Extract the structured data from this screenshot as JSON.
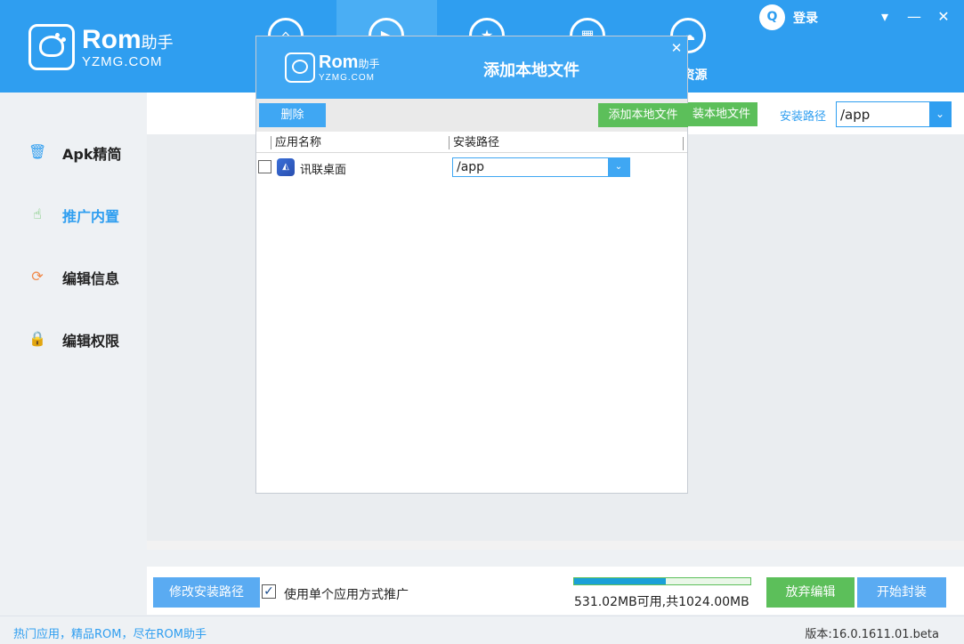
{
  "header": {
    "logo": {
      "title": "Rom",
      "title_suffix": "助手",
      "subtitle": "YZMG.COM"
    },
    "nav_tabs": [
      {
        "icon": "home-icon",
        "label": ""
      },
      {
        "icon": "play-icon",
        "label": ""
      },
      {
        "icon": "star-icon",
        "label": ""
      },
      {
        "icon": "grid-icon",
        "label": ""
      },
      {
        "icon": "cloud-icon",
        "label": "M资源"
      }
    ],
    "login_label": "登录",
    "window_buttons": [
      "dropdown",
      "minimize",
      "close"
    ]
  },
  "sidebar": {
    "items": [
      {
        "icon": "trash-icon",
        "label": "Apk精简",
        "color": "#2f9ef0"
      },
      {
        "icon": "touch-icon",
        "label": "推广内置",
        "color": "#5cbf5a",
        "active": true
      },
      {
        "icon": "refresh-icon",
        "label": "编辑信息",
        "color": "#f08a4b"
      },
      {
        "icon": "lock-icon",
        "label": "编辑权限",
        "color": "#35c29a"
      }
    ]
  },
  "main": {
    "add_button_label": "装本地文件",
    "path_label": "安装路径",
    "path_value": "/app"
  },
  "dialog": {
    "logo": {
      "title": "Rom",
      "title_suffix": "助手",
      "subtitle": "YZMG.COM"
    },
    "title": "添加本地文件",
    "delete_label": "删除",
    "add_label": "添加本地文件",
    "columns": [
      "应用名称",
      "安装路径"
    ],
    "rows": [
      {
        "checked": false,
        "icon": "app-icon",
        "name": "讯联桌面",
        "path": "/app"
      }
    ]
  },
  "footer": {
    "modify_path_label": "修改安装路径",
    "single_app_label": "使用单个应用方式推广",
    "single_app_checked": true,
    "storage_fraction": 0.5185,
    "storage_text": "531.02MB可用,共1024.00MB",
    "discard_label": "放弃编辑",
    "start_label": "开始封装"
  },
  "statusbar": {
    "left_text": "热门应用，精品ROM，尽在ROM助手",
    "version_text": "版本:16.0.1611.01.beta"
  },
  "colors": {
    "brand_blue": "#2f9ef0",
    "green": "#5cbf5a"
  }
}
